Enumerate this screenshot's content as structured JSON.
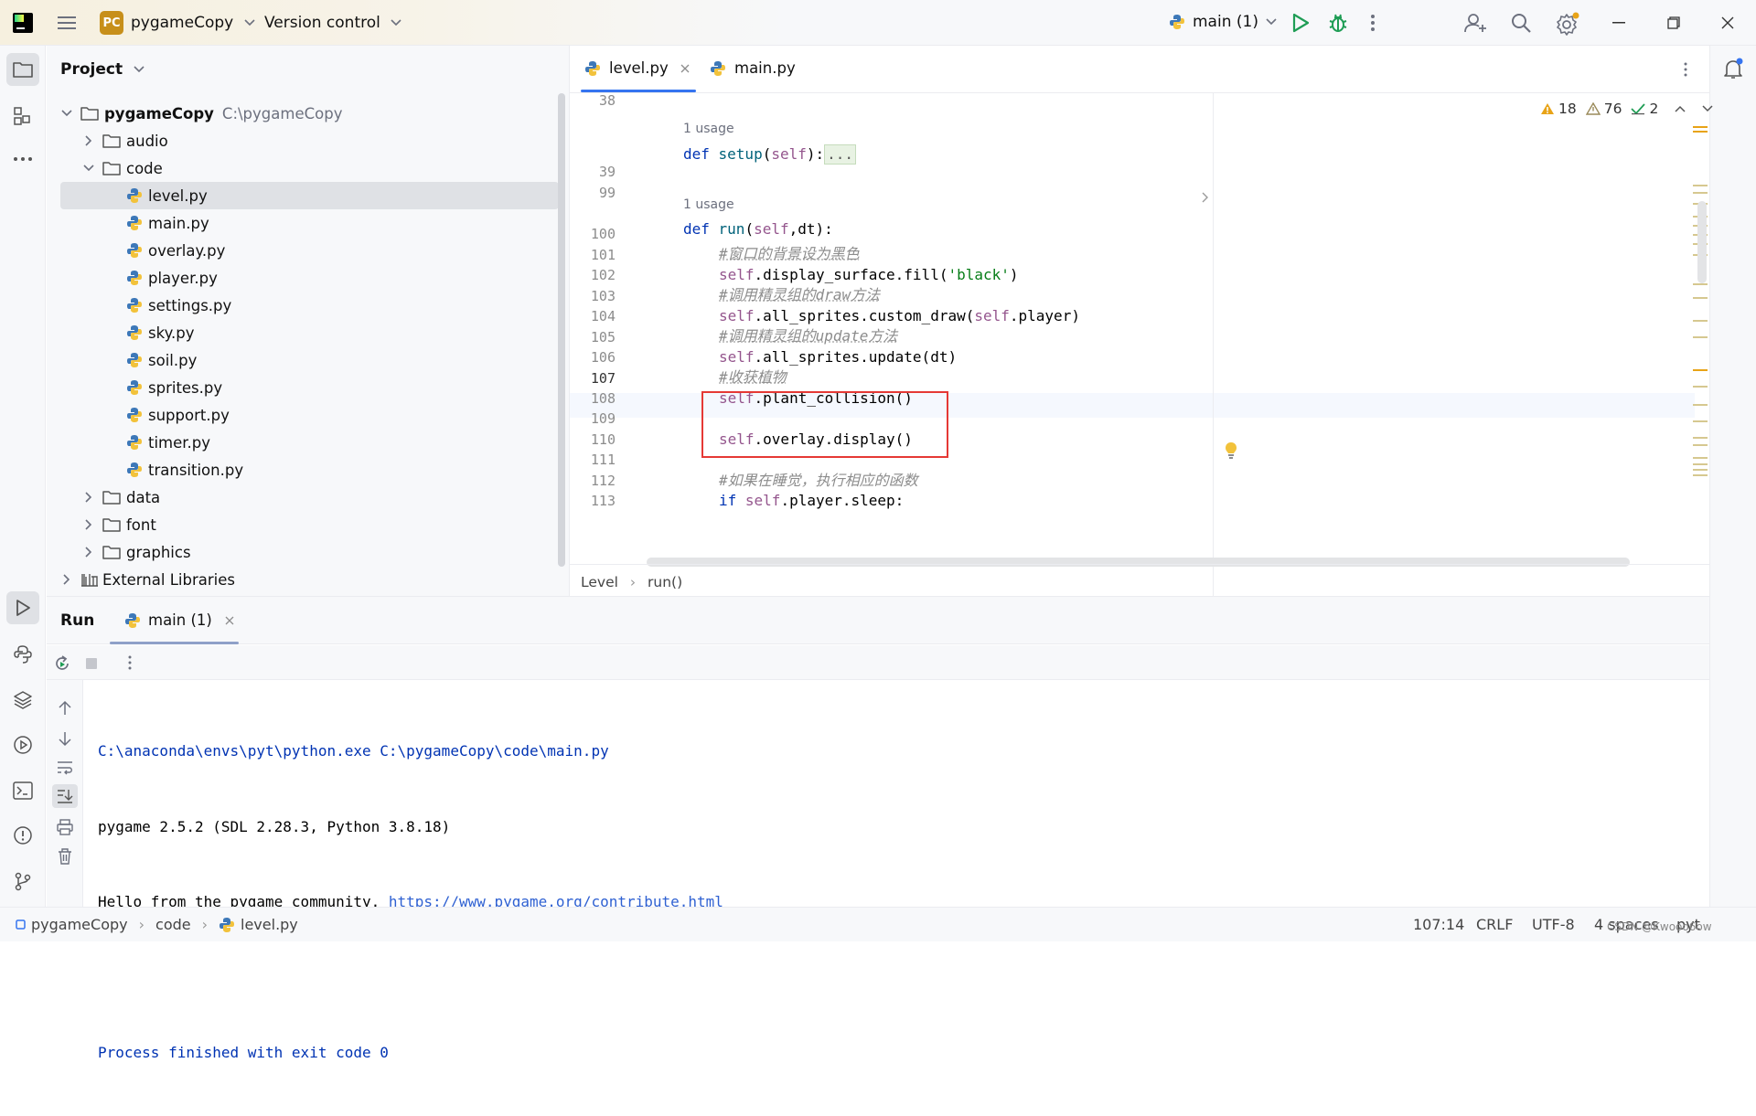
{
  "titlebar": {
    "project_badge": "PC",
    "project_name": "pygameCopy",
    "version_control": "Version control",
    "run_config": "main (1)"
  },
  "project_panel": {
    "title": "Project",
    "root_name": "pygameCopy",
    "root_path": "C:\\pygameCopy",
    "items": [
      {
        "label": "audio"
      },
      {
        "label": "code"
      },
      {
        "label": "level.py"
      },
      {
        "label": "main.py"
      },
      {
        "label": "overlay.py"
      },
      {
        "label": "player.py"
      },
      {
        "label": "settings.py"
      },
      {
        "label": "sky.py"
      },
      {
        "label": "soil.py"
      },
      {
        "label": "sprites.py"
      },
      {
        "label": "support.py"
      },
      {
        "label": "timer.py"
      },
      {
        "label": "transition.py"
      },
      {
        "label": "data"
      },
      {
        "label": "font"
      },
      {
        "label": "graphics"
      },
      {
        "label": "External Libraries"
      }
    ]
  },
  "editor": {
    "tabs": [
      {
        "label": "level.py"
      },
      {
        "label": "main.py"
      }
    ],
    "inspections": {
      "warnings": "18",
      "weak_warnings": "76",
      "ok": "2"
    },
    "usage_hint": "1 usage",
    "fold_placeholder": "...",
    "line_numbers": [
      "38",
      "39",
      "99",
      "100",
      "101",
      "102",
      "103",
      "104",
      "105",
      "106",
      "107",
      "108",
      "109",
      "110",
      "111",
      "112",
      "113"
    ],
    "code": {
      "l39_def": "def ",
      "l39_fn": "setup",
      "l39_rest": "(",
      "l39_self": "self",
      "l39_end": "):",
      "l100_def": "def ",
      "l100_fn": "run",
      "l100_open": "(",
      "l100_self": "self",
      "l100_rest": ",dt):",
      "l101": "#窗口的背景设为黑色",
      "l102_self": "self",
      "l102_mid": ".display_surface.fill(",
      "l102_str": "'black'",
      "l102_end": ")",
      "l103": "#调用精灵组的draw方法",
      "l104_self": "self",
      "l104_mid": ".all_sprites.custom_draw(",
      "l104_self2": "self",
      "l104_end": ".player)",
      "l105": "#调用精灵组的update方法",
      "l106_self": "self",
      "l106_rest": ".all_sprites.update(dt)",
      "l107": "#收获植物",
      "l108_self": "self",
      "l108_rest": ".plant_collision()",
      "l110_self": "self",
      "l110_rest": ".overlay.display()",
      "l112": "#如果在睡觉，执行相应的函数",
      "l113_if": "if ",
      "l113_self": "self",
      "l113_rest": ".player.sleep:"
    },
    "breadcrumb": {
      "class": "Level",
      "method": "run()"
    }
  },
  "run_panel": {
    "title": "Run",
    "tab": "main (1)",
    "console": {
      "line1": "C:\\anaconda\\envs\\pyt\\python.exe C:\\pygameCopy\\code\\main.py",
      "line2": "pygame 2.5.2 (SDL 2.28.3, Python 3.8.18)",
      "line3_text": "Hello from the pygame community. ",
      "line3_link": "https://www.pygame.org/contribute.html",
      "line5": "Process finished with exit code 0"
    }
  },
  "statusbar": {
    "crumb_project": "pygameCopy",
    "crumb_folder": "code",
    "crumb_file": "level.py",
    "position": "107:14",
    "line_ending": "CRLF",
    "encoding": "UTF-8",
    "indent": "4 spaces",
    "interpreter": "pyt",
    "watermark": "CSDN @Kwooo6ow"
  },
  "colors": {
    "accent": "#3574f0",
    "highlight_box": "#e53935",
    "run_green": "#1f9d55",
    "warning": "#e8a317"
  }
}
